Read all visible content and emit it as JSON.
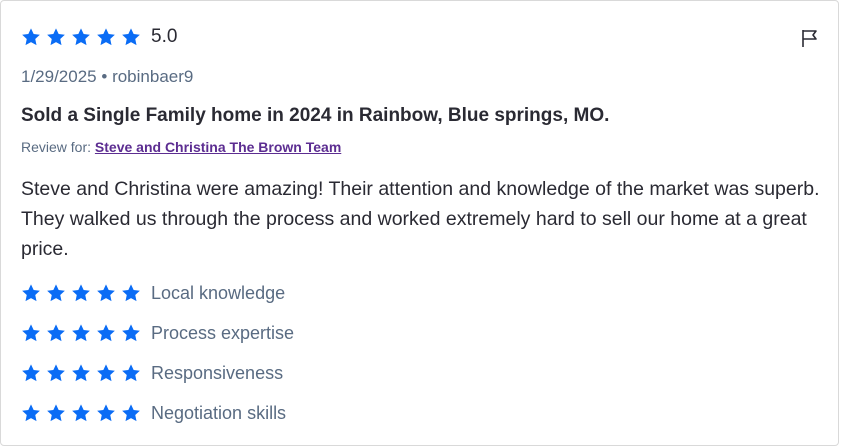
{
  "review": {
    "rating": "5.0",
    "date": "1/29/2025",
    "separator": "•",
    "author": "robinbaer9",
    "title": "Sold a Single Family home in 2024 in Rainbow, Blue springs, MO.",
    "review_for_label": "Review for:",
    "review_for_link": "Steve and Christina The Brown Team",
    "text": "Steve and Christina were amazing! Their attention and knowledge of the market was superb. They walked us through the process and worked extremely hard to sell our home at a great price.",
    "star_rating": 5
  },
  "sub_ratings": [
    {
      "label": "Local knowledge",
      "stars": 5
    },
    {
      "label": "Process expertise",
      "stars": 5
    },
    {
      "label": "Responsiveness",
      "stars": 5
    },
    {
      "label": "Negotiation skills",
      "stars": 5
    }
  ],
  "colors": {
    "star": "#0a6cf5",
    "link": "#5c2d91",
    "text": "#2a2a33",
    "muted": "#596b82"
  },
  "icons": {
    "star": "star-icon",
    "flag": "flag-icon"
  }
}
